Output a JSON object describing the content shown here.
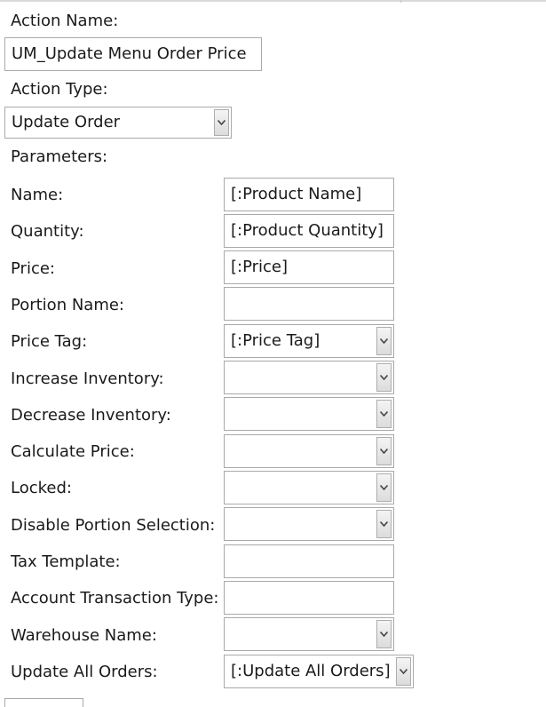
{
  "action": {
    "name_label": "Action Name:",
    "name_value": "UM_Update Menu Order Price",
    "type_label": "Action Type:",
    "type_value": "Update Order",
    "parameters_label": "Parameters:"
  },
  "params": [
    {
      "label": "Name:",
      "value": "[:Product Name]",
      "kind": "text"
    },
    {
      "label": "Quantity:",
      "value": "[:Product Quantity]",
      "kind": "text"
    },
    {
      "label": "Price:",
      "value": "[:Price]",
      "kind": "text"
    },
    {
      "label": "Portion Name:",
      "value": "",
      "kind": "text"
    },
    {
      "label": "Price Tag:",
      "value": "[:Price Tag]",
      "kind": "select"
    },
    {
      "label": "Increase Inventory:",
      "value": "",
      "kind": "select"
    },
    {
      "label": "Decrease Inventory:",
      "value": "",
      "kind": "select"
    },
    {
      "label": "Calculate Price:",
      "value": "",
      "kind": "select"
    },
    {
      "label": "Locked:",
      "value": "",
      "kind": "select"
    },
    {
      "label": "Disable Portion Selection:",
      "value": "",
      "kind": "select"
    },
    {
      "label": "Tax Template:",
      "value": "",
      "kind": "text"
    },
    {
      "label": "Account Transaction Type:",
      "value": "",
      "kind": "text"
    },
    {
      "label": "Warehouse Name:",
      "value": "",
      "kind": "select"
    },
    {
      "label": "Update All Orders:",
      "value": "[:Update All Orders]",
      "kind": "select"
    }
  ]
}
